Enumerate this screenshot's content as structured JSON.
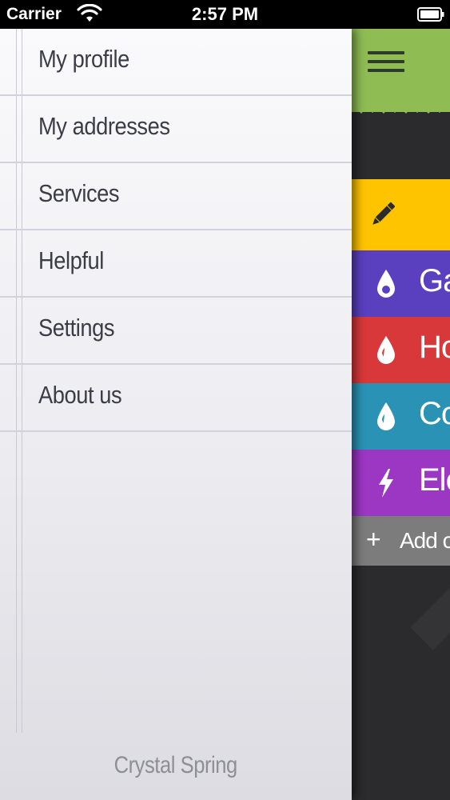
{
  "status_bar": {
    "carrier": "Carrier",
    "time": "2:57 PM",
    "wifi_icon": "wifi-icon",
    "battery_icon": "battery-icon"
  },
  "drawer": {
    "menu_items": [
      {
        "label": "My profile"
      },
      {
        "label": "My addresses"
      },
      {
        "label": "Services"
      },
      {
        "label": "Helpful"
      },
      {
        "label": "Settings"
      },
      {
        "label": "About us"
      }
    ],
    "footer": "Crystal Spring"
  },
  "main": {
    "header_color": "#8fbd54",
    "menu_icon": "hamburger-menu-icon",
    "tiles": [
      {
        "label": "",
        "icon": "pencil-icon",
        "color": "#ffc400"
      },
      {
        "label": "Ga",
        "icon": "water-drop-icon",
        "color": "#5a3fbf"
      },
      {
        "label": "Ho",
        "icon": "water-drop-icon",
        "color": "#d9383a"
      },
      {
        "label": "Co",
        "icon": "water-drop-icon",
        "color": "#2a93b5"
      },
      {
        "label": "Ele",
        "icon": "lightning-icon",
        "color": "#9b37c3"
      }
    ],
    "add_tile": {
      "plus": "+",
      "label": "Add co"
    }
  }
}
